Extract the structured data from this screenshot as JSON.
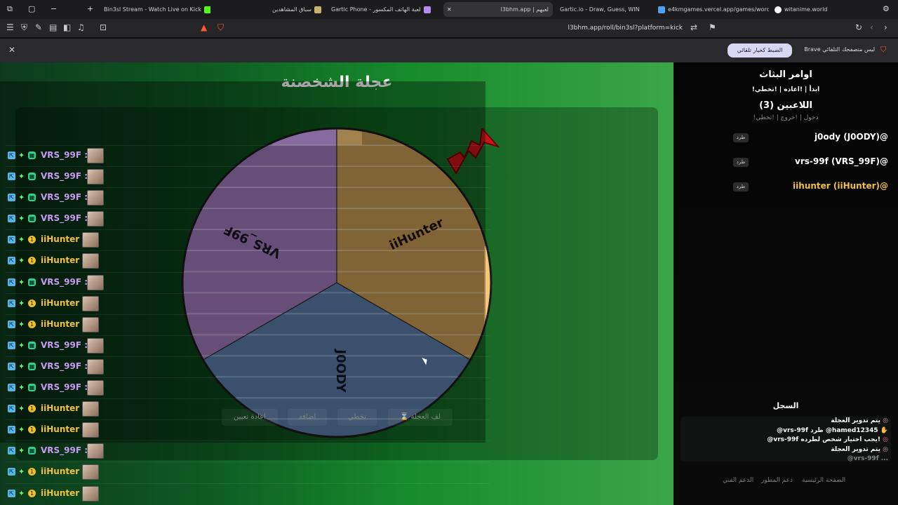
{
  "browser": {
    "tabs": [
      {
        "label": "Bin3sl Stream - Watch Live on Kick",
        "fav_color": "#53fc18"
      },
      {
        "label": "سباق المشاهدين",
        "fav_color": "#c9b26a"
      },
      {
        "label": "Gartic Phone - لعبة الهاتف المكسور",
        "fav_color": "#b48df0"
      },
      {
        "label": "l3bhm.app | لعبهم",
        "fav_color": "#eeeeee"
      },
      {
        "label": "Gartic.io - Draw, Guess, WIN",
        "fav_color": "#2b2b2b"
      },
      {
        "label": "e4kmgames.vercel.app/games/word",
        "fav_color": "#4aa3f0"
      },
      {
        "label": "witanime.world",
        "fav_color": "#ffffff"
      }
    ],
    "url": "l3bhm.app/roll/bin3sl?platform=kick",
    "infobar_text": "Brave ليس متصفحك التلقائي",
    "infobar_button": "الضبط كخيار تلقائي"
  },
  "wheel": {
    "title": "عجلة الشخصنة",
    "segments": [
      {
        "name": "iiHunter",
        "color": "#c79a52"
      },
      {
        "name": "J0ODY",
        "color": "#5a7ca8"
      },
      {
        "name": "VRS_99F",
        "color": "#9d78b8"
      }
    ]
  },
  "chat": [
    {
      "name": "VRS_99F :",
      "color": "#c59cf0",
      "badge": "purple"
    },
    {
      "name": "VRS_99F :",
      "color": "#c59cf0",
      "badge": "purple"
    },
    {
      "name": "VRS_99F :",
      "color": "#c59cf0",
      "badge": "purple"
    },
    {
      "name": "VRS_99F :",
      "color": "#c59cf0",
      "badge": "purple"
    },
    {
      "name": "iiHunter :",
      "color": "#f0c040",
      "badge": "gold"
    },
    {
      "name": "iiHunter :",
      "color": "#f0c040",
      "badge": "gold"
    },
    {
      "name": "VRS_99F :",
      "color": "#c59cf0",
      "badge": "purple"
    },
    {
      "name": "iiHunter :",
      "color": "#f0c040",
      "badge": "gold"
    },
    {
      "name": "iiHunter :",
      "color": "#f0c040",
      "badge": "gold"
    },
    {
      "name": "VRS_99F :",
      "color": "#c59cf0",
      "badge": "purple"
    },
    {
      "name": "VRS_99F :",
      "color": "#c59cf0",
      "badge": "purple"
    },
    {
      "name": "VRS_99F :",
      "color": "#c59cf0",
      "badge": "purple"
    },
    {
      "name": "iiHunter :",
      "color": "#f0c040",
      "badge": "gold"
    },
    {
      "name": "iiHunter :",
      "color": "#f0c040",
      "badge": "gold"
    },
    {
      "name": "VRS_99F :",
      "color": "#c59cf0",
      "badge": "purple"
    },
    {
      "name": "iiHunter :",
      "color": "#f0c040",
      "badge": "gold"
    },
    {
      "name": "iiHunter :",
      "color": "#f0c040",
      "badge": "gold"
    }
  ],
  "controls": {
    "spin": "⌛ لف العجلة",
    "skip": "تخطي",
    "add": "اضافه",
    "reset": "اعادة تعيين"
  },
  "sidebar": {
    "commands_title": "اوامر البثاث",
    "commands": "!ابدأ | !اعاده | !تخطي",
    "players_title": "اللاعبين (3)",
    "players_sub": "!دخول | !خروج | !تخطي",
    "kick_label": "طرد",
    "players": [
      {
        "label": "j0ody (J0ODY)@",
        "color": "#ffffff"
      },
      {
        "label": "vrs-99f (VRS_99F)@",
        "color": "#ffffff"
      },
      {
        "label": "iihunter (iiHunter)@",
        "color": "#f0c040"
      }
    ],
    "log_title": "السجل",
    "log": [
      "يتم تدوير العجلة",
      "@vrs-99f طرد @hamed12345",
      "@vrs-99f يجب اختيار شخص لطرده!",
      "يتم تدوير العجلة",
      "@vrs-99f ..."
    ],
    "footer": [
      "الصفحة الرئيسية",
      "دعم المطور",
      "الدعم الفني"
    ]
  }
}
